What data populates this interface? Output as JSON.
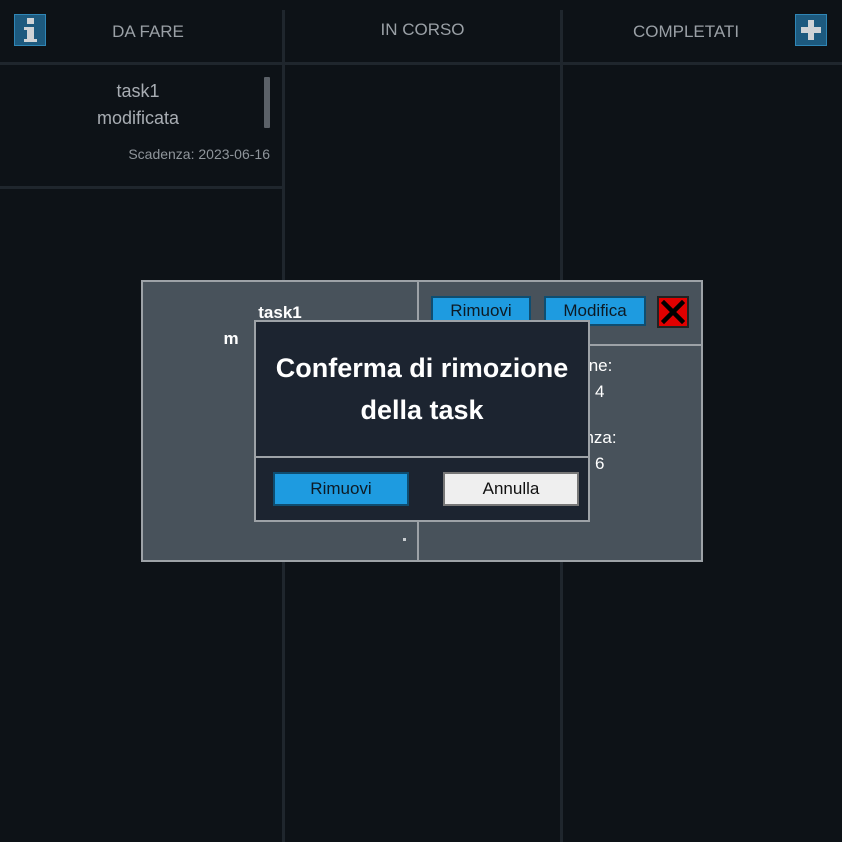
{
  "columns": {
    "todo": "DA FARE",
    "in_progress": "IN CORSO",
    "done": "COMPLETATI"
  },
  "task": {
    "title_line1": "task1",
    "title_line2": "modificata",
    "due": "Scadenza: 2023-06-16"
  },
  "detail": {
    "title_line1": "task1",
    "title_line2_visible": "m",
    "remove_label": "Rimuovi",
    "edit_label": "Modifica",
    "creation_label_partial": "zione:",
    "creation_value_partial": "4",
    "due_label_partial": "enza:",
    "due_value_partial": "6"
  },
  "confirm": {
    "message_line1": "Conferma di rimozione",
    "message_line2": "della task",
    "remove_label": "Rimuovi",
    "cancel_label": "Annulla"
  },
  "icons": {
    "info": "info-icon",
    "add": "plus-icon",
    "close": "close-icon"
  },
  "colors": {
    "accent": "#1e9be0",
    "close": "#e00000",
    "background": "#0d1217"
  }
}
